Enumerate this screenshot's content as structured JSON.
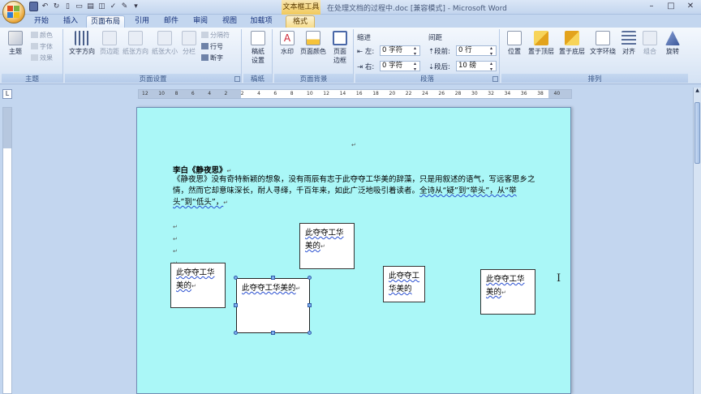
{
  "titlebar": {
    "context_tool": "文本框工具",
    "title": "在处理文档的过程中.doc [兼容模式] - Microsoft Word",
    "minimize": "–",
    "maximize": "□",
    "close": "✕"
  },
  "tabs": {
    "home": "开始",
    "insert": "插入",
    "page_layout": "页面布局",
    "references": "引用",
    "mailings": "邮件",
    "review": "审阅",
    "view": "视图",
    "addins": "加载项",
    "format": "格式"
  },
  "ribbon": {
    "theme_group": {
      "label": "主题",
      "theme_btn": "主题",
      "colors": "颜色",
      "fonts": "字体",
      "effects": "效果"
    },
    "page_setup": {
      "label": "页面设置",
      "text_direction": "文字方向",
      "margins": "页边距",
      "orientation": "纸张方向",
      "size": "纸张大小",
      "columns": "分栏",
      "breaks": "分隔符",
      "line_numbers": "行号",
      "hyphenation": "断字"
    },
    "draft_paper": {
      "label": "稿纸",
      "btn_line1": "稿纸",
      "btn_line2": "设置"
    },
    "page_background": {
      "label": "页面背景",
      "watermark": "水印",
      "page_color": "页面颜色",
      "page_border_line1": "页面",
      "page_border_line2": "边框"
    },
    "paragraph": {
      "label": "段落",
      "indent": "缩进",
      "left": "左:",
      "right": "右:",
      "left_value": "0 字符",
      "right_value": "0 字符",
      "spacing": "间距",
      "before": "段前:",
      "after": "段后:",
      "before_value": "0 行",
      "after_value": "10 磅"
    },
    "arrange": {
      "label": "排列",
      "position": "位置",
      "bring_front": "置于顶层",
      "send_back": "置于底层",
      "wrap": "文字环绕",
      "align": "对齐",
      "group": "组合",
      "rotate": "旋转"
    }
  },
  "ruler": {
    "ticks": [
      "12",
      "10",
      "8",
      "6",
      "4",
      "2",
      "2",
      "4",
      "6",
      "8",
      "10",
      "12",
      "14",
      "16",
      "18",
      "20",
      "22",
      "24",
      "26",
      "28",
      "30",
      "32",
      "34",
      "36",
      "38",
      "40"
    ]
  },
  "document": {
    "title": "李白《静夜思》",
    "body_part1": "《静夜思》没有奇特新颖的想象，没有雨辰有志于此夺夺工华美的辞藻，只是用叙述的语气，写远客思乡之情，然而它却意味深长，耐人寻绎，千百年来，如此广泛地吸引着读者。",
    "body_part2": "全诗从“疑”到“举头”，从“举头”到“低头”，",
    "para_mark": "↵",
    "textboxes": {
      "box1": "此夺夺工华美的",
      "box2": "此夺夺工华美的",
      "box3": "此夺夺工华美的",
      "box4": "此夺夺工华美的",
      "box5": "此夺夺工华美的"
    }
  },
  "colors": {
    "page_background": "#aaf7f7",
    "ribbon_accent": "#f6dc8c"
  }
}
